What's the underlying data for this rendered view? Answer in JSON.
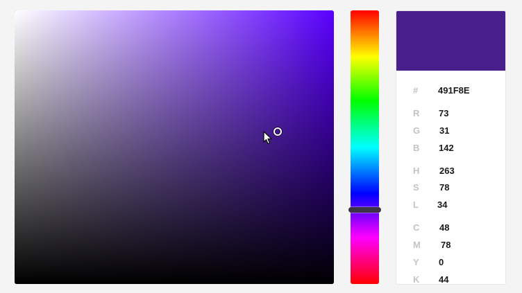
{
  "colors": {
    "selected": "#491F8E",
    "hue_base": "#5a00ff"
  },
  "sv_picker": {
    "saturation_percent": 78,
    "brightness_percent": 56
  },
  "hue_slider": {
    "hue_degrees": 263
  },
  "info": {
    "hex_label": "#",
    "hex_value": "491F8E",
    "r_label": "R",
    "r_value": "73",
    "g_label": "G",
    "g_value": "31",
    "b_label": "B",
    "b_value": "142",
    "h_label": "H",
    "h_value": "263",
    "s_label": "S",
    "s_value": "78",
    "l_label": "L",
    "l_value": "34",
    "c_label": "C",
    "c_value": "48",
    "m_label": "M",
    "m_value": "78",
    "y_label": "Y",
    "y_value": "0",
    "k_label": "K",
    "k_value": "44"
  },
  "icons": {
    "cursor": "mouse-pointer-icon"
  }
}
